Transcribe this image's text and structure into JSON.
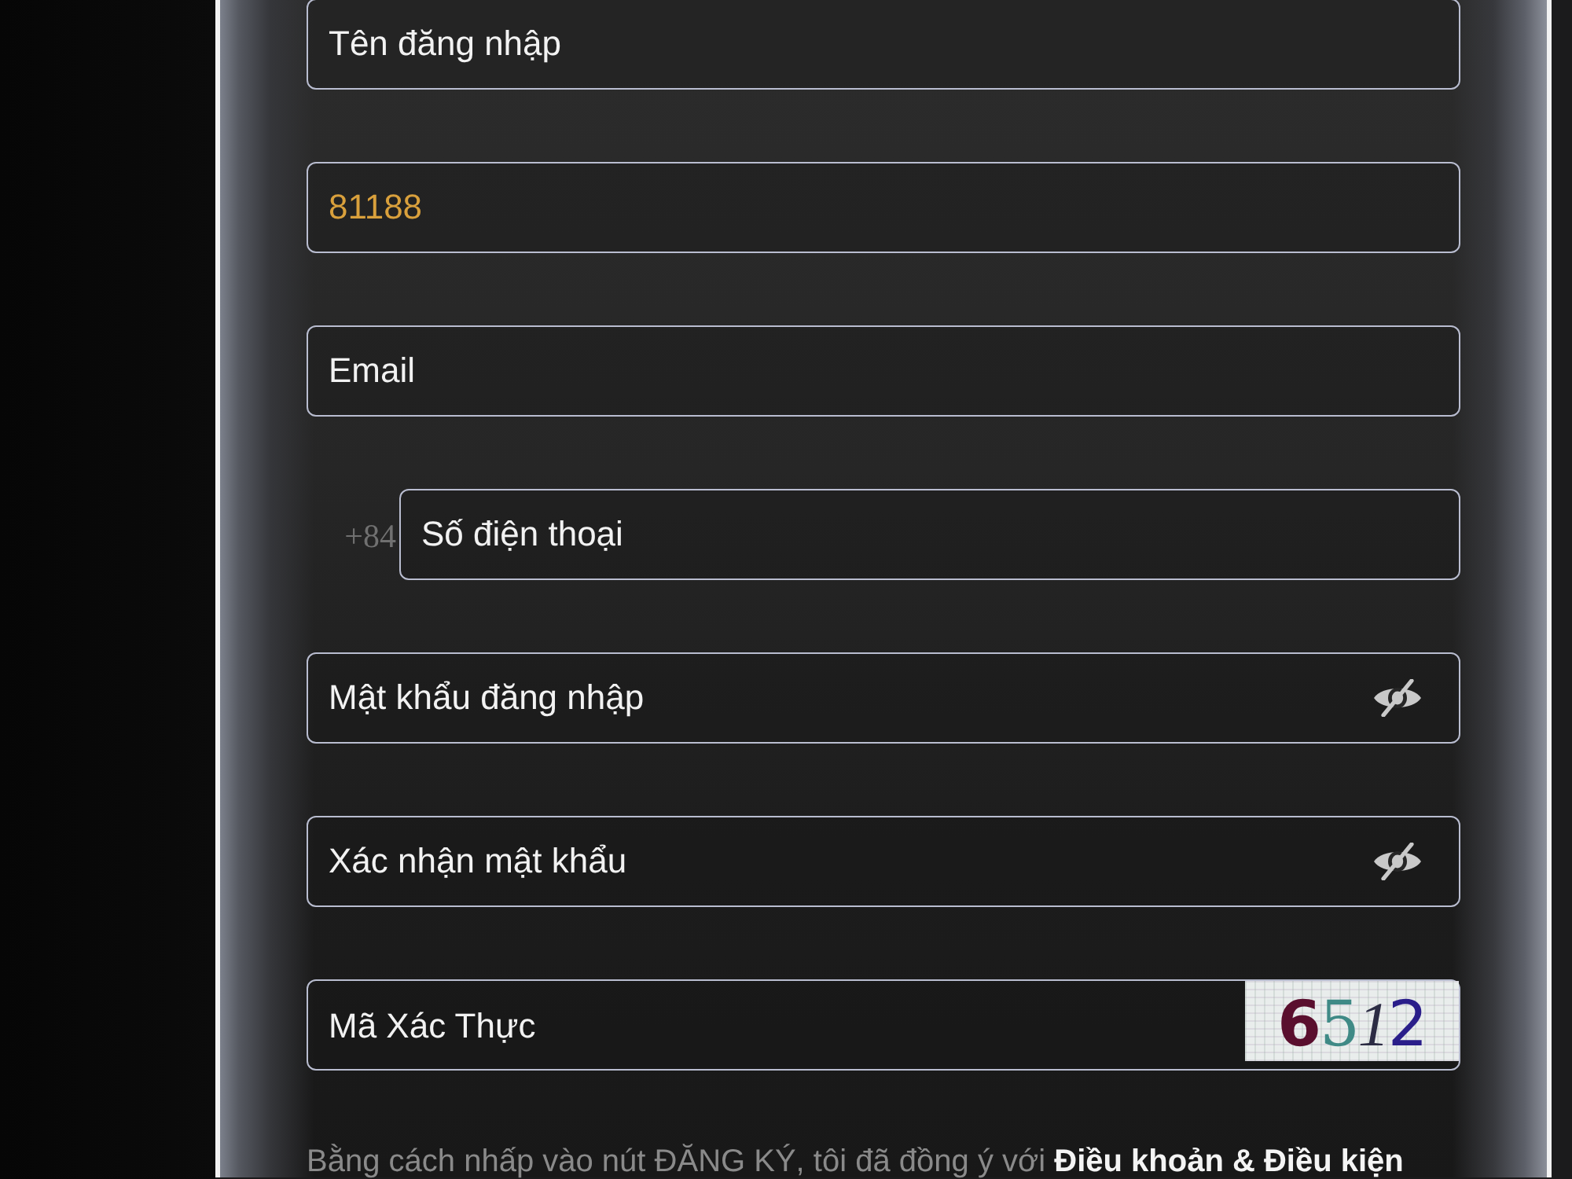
{
  "fields": [
    {
      "kind": "text",
      "placeholder": "Tên đăng nhập"
    },
    {
      "kind": "text",
      "value": "81188"
    },
    {
      "kind": "text",
      "placeholder": "Email"
    },
    {
      "kind": "phone",
      "prefix": "+84",
      "placeholder": "Số điện thoại"
    },
    {
      "kind": "password",
      "placeholder": "Mật khẩu đăng nhập"
    },
    {
      "kind": "password",
      "placeholder": "Xác nhận mật khẩu"
    },
    {
      "kind": "captcha",
      "placeholder": "Mã Xác Thực",
      "captcha": "6512"
    }
  ],
  "terms": {
    "text": "Bằng cách nhấp vào nút ĐĂNG KÝ, tôi đã đồng ý với",
    "link": "Điều khoản & Điều kiện"
  }
}
